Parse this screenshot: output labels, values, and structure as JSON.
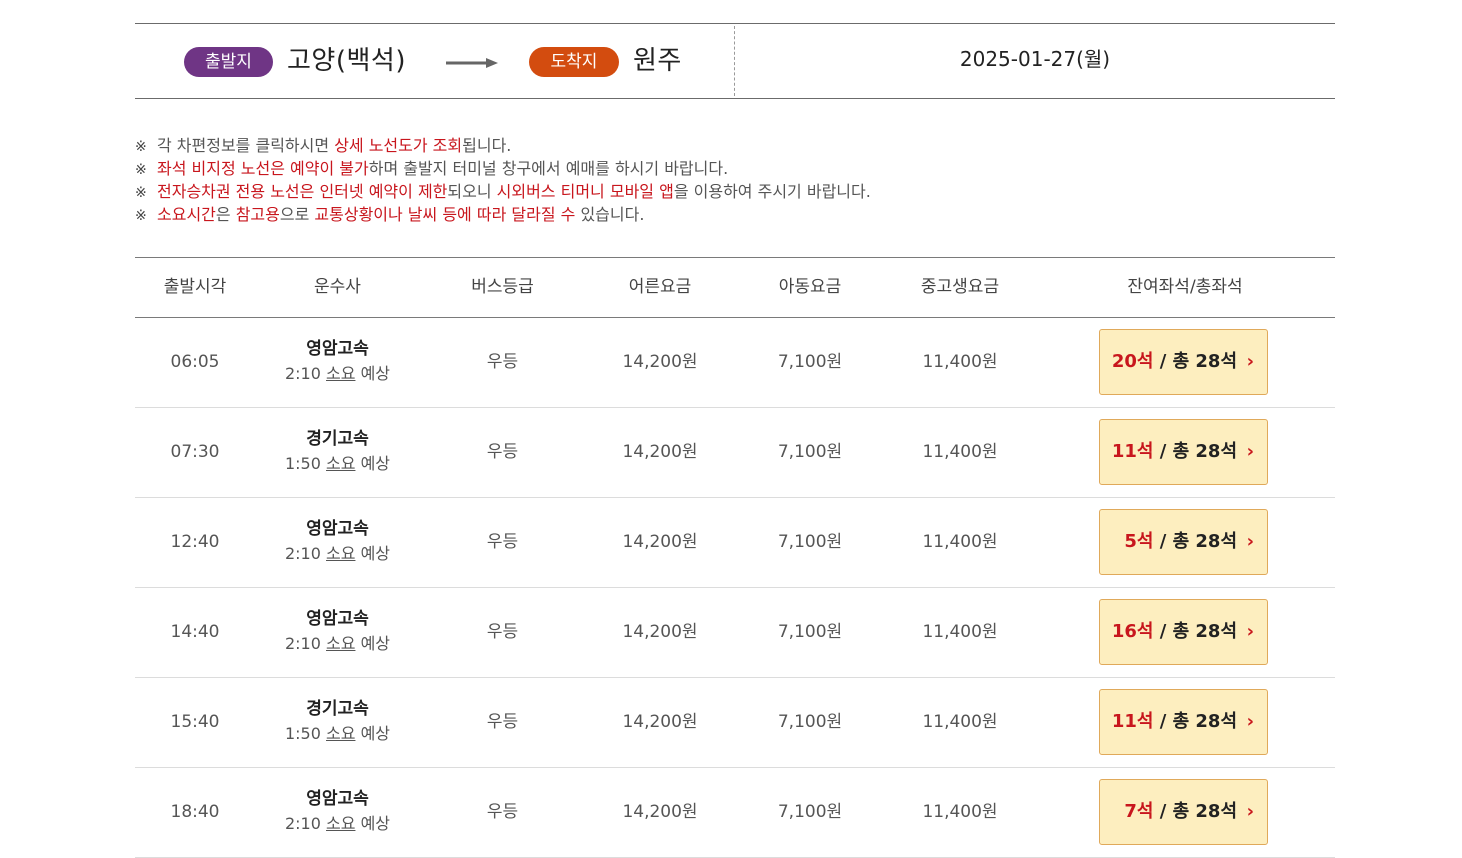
{
  "route": {
    "departure_badge": "출발지",
    "departure_city": "고양(백석)",
    "arrival_badge": "도착지",
    "arrival_city": "원주",
    "date": "2025-01-27(월)"
  },
  "notices": [
    {
      "mark": "※",
      "parts": [
        {
          "text": "각 차편정보를 클릭하시면 ",
          "red": false
        },
        {
          "text": "상세 노선도가 조회",
          "red": true
        },
        {
          "text": "됩니다.",
          "red": false
        }
      ]
    },
    {
      "mark": "※",
      "parts": [
        {
          "text": "좌석 비지정 노선은 예약이 불가",
          "red": true
        },
        {
          "text": "하며 출발지 터미널 창구에서 예매를 하시기 바랍니다.",
          "red": false
        }
      ]
    },
    {
      "mark": "※",
      "parts": [
        {
          "text": "전자승차권 전용 노선은 인터넷 예약이 제한",
          "red": true
        },
        {
          "text": "되오니 ",
          "red": false
        },
        {
          "text": "시외버스 티머니 모바일 앱",
          "red": true
        },
        {
          "text": "을 이용하여 주시기 바랍니다.",
          "red": false
        }
      ]
    },
    {
      "mark": "※",
      "parts": [
        {
          "text": "소요시간",
          "red": true
        },
        {
          "text": "은 ",
          "red": false
        },
        {
          "text": "참고용",
          "red": true
        },
        {
          "text": "으로 ",
          "red": false
        },
        {
          "text": "교통상황이나 날씨 등에 따라 달라질 수",
          "red": true
        },
        {
          "text": " 있습니다.",
          "red": false
        }
      ]
    }
  ],
  "table": {
    "headers": {
      "departure_time": "출발시각",
      "company": "운수사",
      "bus_class": "버스등급",
      "adult_fare": "어른요금",
      "child_fare": "아동요금",
      "student_fare": "중고생요금",
      "seats": "잔여좌석/총좌석"
    },
    "rows": [
      {
        "time": "06:05",
        "company": "영암고속",
        "duration": "2:10",
        "soyo": "소요",
        "expect": "예상",
        "class": "우등",
        "adult": "14,200원",
        "child": "7,100원",
        "student": "11,400원",
        "remain": "20석",
        "sep": " / ",
        "total": "총 28석",
        "chev": "›"
      },
      {
        "time": "07:30",
        "company": "경기고속",
        "duration": "1:50",
        "soyo": "소요",
        "expect": "예상",
        "class": "우등",
        "adult": "14,200원",
        "child": "7,100원",
        "student": "11,400원",
        "remain": "11석",
        "sep": " / ",
        "total": "총 28석",
        "chev": "›"
      },
      {
        "time": "12:40",
        "company": "영암고속",
        "duration": "2:10",
        "soyo": "소요",
        "expect": "예상",
        "class": "우등",
        "adult": "14,200원",
        "child": "7,100원",
        "student": "11,400원",
        "remain": "5석",
        "sep": " / ",
        "total": "총 28석",
        "chev": "›"
      },
      {
        "time": "14:40",
        "company": "영암고속",
        "duration": "2:10",
        "soyo": "소요",
        "expect": "예상",
        "class": "우등",
        "adult": "14,200원",
        "child": "7,100원",
        "student": "11,400원",
        "remain": "16석",
        "sep": " / ",
        "total": "총 28석",
        "chev": "›"
      },
      {
        "time": "15:40",
        "company": "경기고속",
        "duration": "1:50",
        "soyo": "소요",
        "expect": "예상",
        "class": "우등",
        "adult": "14,200원",
        "child": "7,100원",
        "student": "11,400원",
        "remain": "11석",
        "sep": " / ",
        "total": "총 28석",
        "chev": "›"
      },
      {
        "time": "18:40",
        "company": "영암고속",
        "duration": "2:10",
        "soyo": "소요",
        "expect": "예상",
        "class": "우등",
        "adult": "14,200원",
        "child": "7,100원",
        "student": "11,400원",
        "remain": "7석",
        "sep": " / ",
        "total": "총 28석",
        "chev": "›"
      }
    ]
  },
  "colors": {
    "departure_badge": "#6f3585",
    "arrival_badge": "#d34c0f",
    "highlight_red": "#c8161d",
    "seat_button_bg": "#fdeebf",
    "seat_button_border": "#e0a95a"
  },
  "icons": {
    "route_arrow": "right-arrow-icon",
    "seat_chevron": "chevron-right-icon"
  }
}
